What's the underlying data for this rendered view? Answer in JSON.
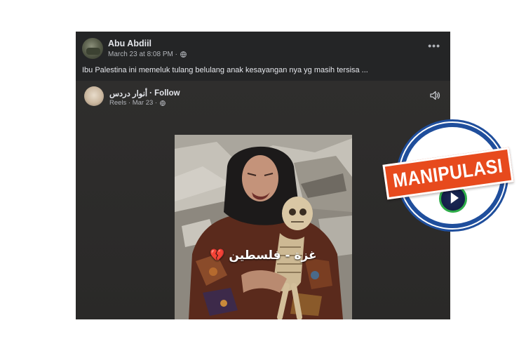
{
  "post": {
    "author": "Abu Abdiil",
    "timestamp": "March 23 at 8:08 PM ·",
    "caption": "Ibu Palestina ini memeluk tulang belulang anak kesayangan nya yg masih tersisa ...",
    "privacy_icon": "globe-icon",
    "menu_icon": "more-options-icon"
  },
  "reel": {
    "author": "أنوار دردس",
    "follow_label": "· Follow",
    "meta": "Reels · Mar 23 ·",
    "privacy_icon": "globe-icon",
    "sound_icon": "speaker-icon",
    "overlay_text": "💔 غزة - فلسطين"
  },
  "badge": {
    "label": "MANIPULASI",
    "banner_color": "#e74a1d",
    "ring_color": "#1f4e9c",
    "logo_accent": "#2fae4a"
  },
  "colors": {
    "post_background": "#242526",
    "text_primary": "#e4e6eb",
    "text_secondary": "#b0b3b8"
  }
}
